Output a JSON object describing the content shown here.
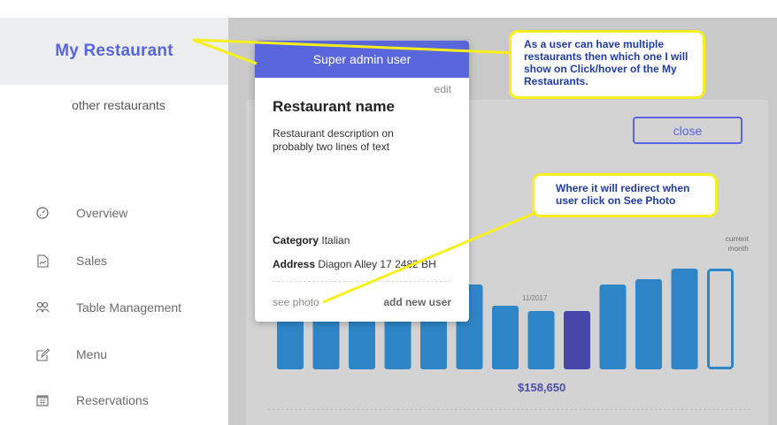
{
  "sidebar": {
    "brand": "My Restaurant",
    "other_restaurants": "other restaurants",
    "nav": [
      {
        "label": "Overview",
        "icon": "gauge-icon"
      },
      {
        "label": "Sales",
        "icon": "chart-file-icon"
      },
      {
        "label": "Table Management",
        "icon": "users-icon"
      },
      {
        "label": "Menu",
        "icon": "edit-icon"
      },
      {
        "label": "Reservations",
        "icon": "calendar-icon"
      }
    ]
  },
  "dashboard": {
    "close_label": "close",
    "current_month_label": "current\nmonth",
    "bar_month_label": "11/2017",
    "total": "$158,650"
  },
  "popover": {
    "header": "Super admin user",
    "edit": "edit",
    "title": "Restaurant name",
    "description": "Restaurant description on probably two lines of text",
    "category_key": "Category",
    "category_value": "Italian",
    "address_key": "Address",
    "address_value": "Diagon Alley 17 2482 BH",
    "see_photo": "see photo",
    "add_user": "add new user"
  },
  "annotations": {
    "restaurants_note": "As a user can have multiple restaurants then which one I will show on Click/hover of the My Restaurants.",
    "photo_note": "Where it will redirect when user click on See Photo"
  },
  "chart_data": {
    "type": "bar",
    "values": [
      70,
      70,
      70,
      70,
      70,
      80,
      60,
      55,
      55,
      80,
      85,
      95,
      95
    ],
    "highlight_index": 8,
    "current_index": 12,
    "colors": {
      "bar": "#2e86c8",
      "highlight": "#4646a8",
      "current_outline": "#2e86c8"
    }
  },
  "colors": {
    "accent": "#5865dd",
    "callout_border": "#f7ef1c",
    "callout_text": "#1f3ca6"
  }
}
